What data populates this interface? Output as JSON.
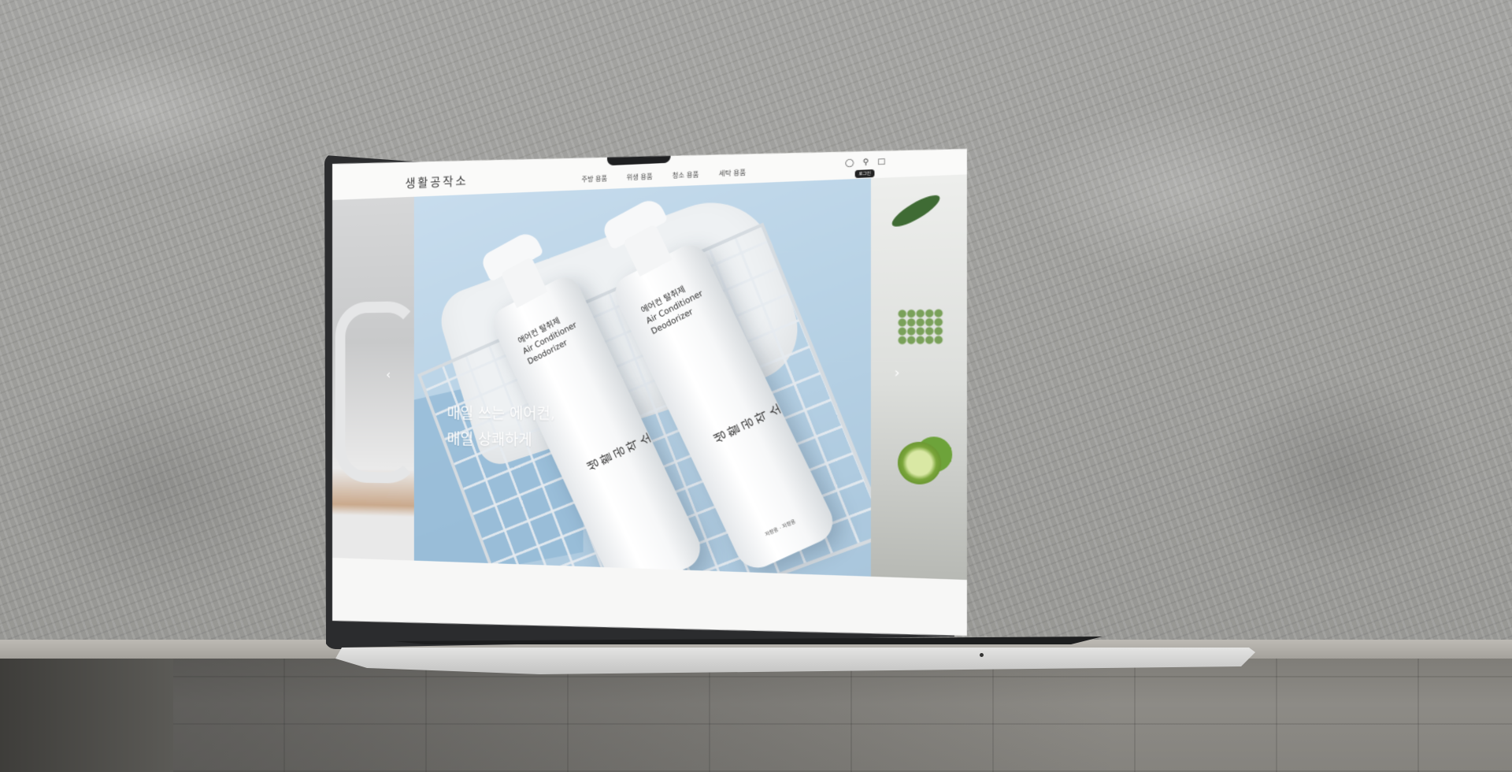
{
  "site": {
    "brand": "생활공작소",
    "nav": [
      {
        "label": "주방 용품"
      },
      {
        "label": "위생 용품"
      },
      {
        "label": "청소 용품"
      },
      {
        "label": "세탁 용품"
      }
    ],
    "header_icons": [
      "user-icon",
      "search-icon",
      "cart-icon"
    ],
    "login_badge": "로그인"
  },
  "hero": {
    "headline_line1": "매일 쓰는 에어컨,",
    "headline_line2": "매일 상쾌하게",
    "prev_arrow": "‹",
    "next_arrow": "›",
    "product": {
      "label_kr": "에어컨 탈취제",
      "label_en_1": "Air Conditioner",
      "label_en_2": "Deodorizer",
      "bottle_brand": "생활공작소",
      "bottle_note": "저향용 · 저향용"
    }
  },
  "colors": {
    "hero_bg": "#b9d3e6",
    "header_bg": "#fafaf9",
    "laptop_frame": "#2b2c2e"
  }
}
